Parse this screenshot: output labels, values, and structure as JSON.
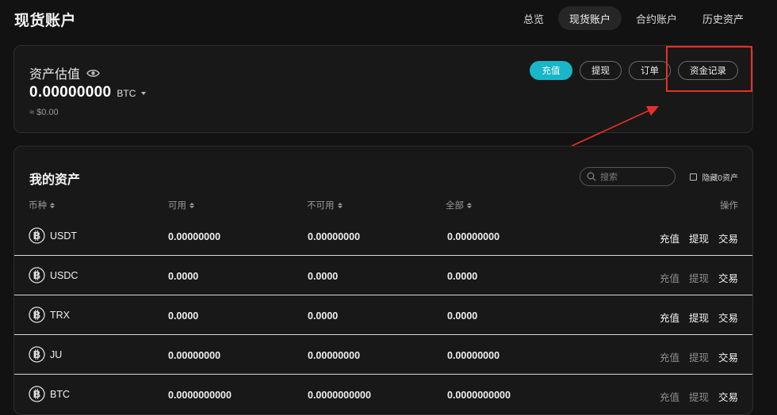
{
  "page": {
    "title": "现货账户"
  },
  "topnav": {
    "tabs": [
      {
        "label": "总览",
        "active": false
      },
      {
        "label": "现货账户",
        "active": true
      },
      {
        "label": "合约账户",
        "active": false
      },
      {
        "label": "历史资产",
        "active": false
      }
    ]
  },
  "summary": {
    "label": "资产估值",
    "value": "0.00000000",
    "currency": "BTC",
    "fiat": "≈ $0.00",
    "buttons": {
      "deposit": "充值",
      "withdraw": "提现",
      "orders": "订单",
      "fund_records": "资金记录"
    }
  },
  "assets": {
    "title": "我的资产",
    "search_placeholder": "搜索",
    "hide_zero_label": "隐藏0资产",
    "columns": {
      "coin": "币种",
      "available": "可用",
      "unavailable": "不可用",
      "total": "全部",
      "actions": "操作"
    },
    "rows": [
      {
        "coin": "USDT",
        "available": "0.00000000",
        "unavailable": "0.00000000",
        "total": "0.00000000",
        "deposit": "充值",
        "withdraw": "提现",
        "trade": "交易",
        "deposit_enabled": true,
        "withdraw_enabled": true
      },
      {
        "coin": "USDC",
        "available": "0.0000",
        "unavailable": "0.0000",
        "total": "0.0000",
        "deposit": "充值",
        "withdraw": "提现",
        "trade": "交易",
        "deposit_enabled": false,
        "withdraw_enabled": false
      },
      {
        "coin": "TRX",
        "available": "0.0000",
        "unavailable": "0.0000",
        "total": "0.0000",
        "deposit": "充值",
        "withdraw": "提现",
        "trade": "交易",
        "deposit_enabled": true,
        "withdraw_enabled": true
      },
      {
        "coin": "JU",
        "available": "0.00000000",
        "unavailable": "0.00000000",
        "total": "0.00000000",
        "deposit": "充值",
        "withdraw": "提现",
        "trade": "交易",
        "deposit_enabled": false,
        "withdraw_enabled": false
      },
      {
        "coin": "BTC",
        "available": "0.0000000000",
        "unavailable": "0.0000000000",
        "total": "0.0000000000",
        "deposit": "充值",
        "withdraw": "提现",
        "trade": "交易",
        "deposit_enabled": false,
        "withdraw_enabled": false
      }
    ]
  },
  "colors": {
    "accent": "#18b6c8",
    "annotation": "#e8302a",
    "background": "#121212"
  }
}
